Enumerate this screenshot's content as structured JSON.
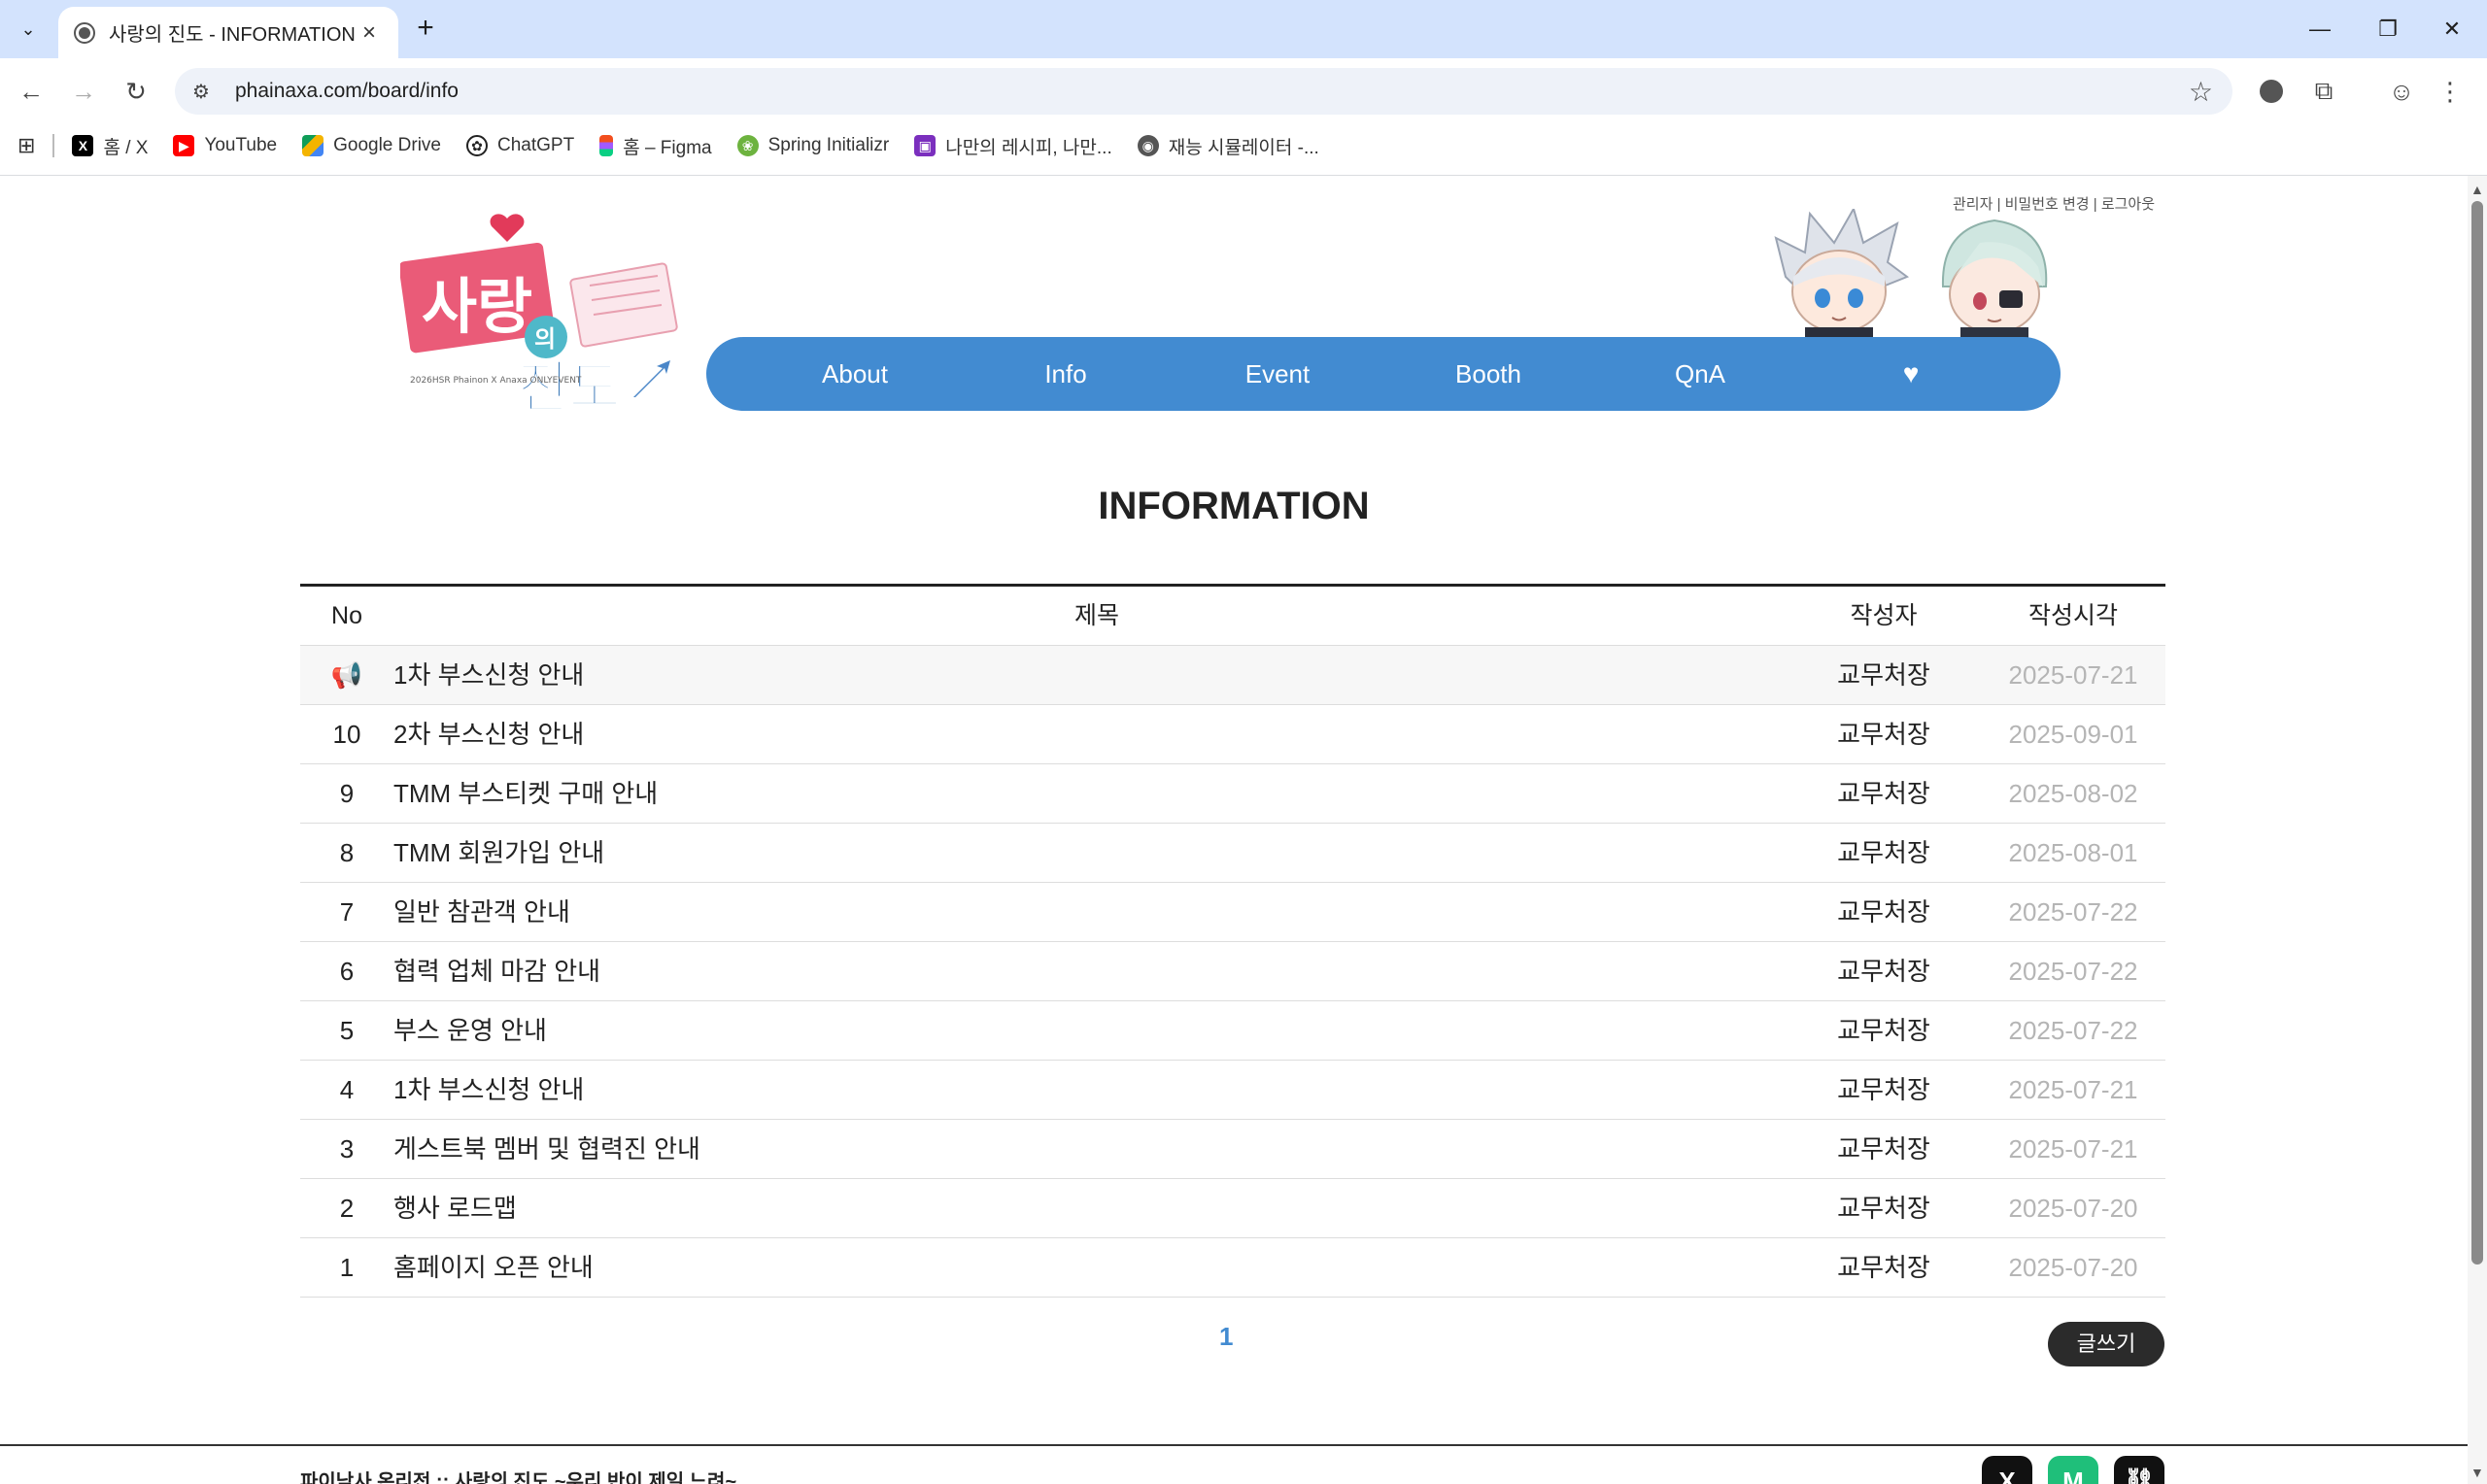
{
  "browser": {
    "tab_title": "사랑의 진도 - INFORMATION",
    "url": "phainaxa.com/board/info",
    "bookmarks": [
      {
        "label": "홈 / X",
        "icon": "x-logo-icon"
      },
      {
        "label": "YouTube",
        "icon": "youtube-icon"
      },
      {
        "label": "Google Drive",
        "icon": "google-drive-icon"
      },
      {
        "label": "ChatGPT",
        "icon": "chatgpt-icon"
      },
      {
        "label": "홈 – Figma",
        "icon": "figma-icon"
      },
      {
        "label": "Spring Initializr",
        "icon": "spring-icon"
      },
      {
        "label": "나만의 레시피, 나만...",
        "icon": "recipe-icon"
      },
      {
        "label": "재능 시뮬레이터 -...",
        "icon": "globe-icon"
      }
    ]
  },
  "site": {
    "top_links": "관리자 | 비밀번호 변경 | 로그아웃",
    "logo_lines": {
      "main1": "사랑",
      "small": "의",
      "main2": "진도",
      "sub": "2026HSR Phainon X Anaxa ONLYEVENT"
    },
    "nav": [
      {
        "label": "About"
      },
      {
        "label": "Info"
      },
      {
        "label": "Event"
      },
      {
        "label": "Booth"
      },
      {
        "label": "QnA"
      }
    ],
    "accent_color": "#428bd1"
  },
  "board": {
    "title": "INFORMATION",
    "columns": {
      "no": "No",
      "title": "제목",
      "author": "작성자",
      "date": "작성시각"
    },
    "notice_icon": "📢",
    "rows": [
      {
        "no": "",
        "title": "1차 부스신청 안내",
        "author": "교무처장",
        "date": "2025-07-21",
        "notice": true
      },
      {
        "no": "10",
        "title": "2차 부스신청 안내",
        "author": "교무처장",
        "date": "2025-09-01"
      },
      {
        "no": "9",
        "title": "TMM 부스티켓 구매 안내",
        "author": "교무처장",
        "date": "2025-08-02"
      },
      {
        "no": "8",
        "title": "TMM 회원가입 안내",
        "author": "교무처장",
        "date": "2025-08-01"
      },
      {
        "no": "7",
        "title": "일반 참관객 안내",
        "author": "교무처장",
        "date": "2025-07-22"
      },
      {
        "no": "6",
        "title": "협력 업체 마감 안내",
        "author": "교무처장",
        "date": "2025-07-22"
      },
      {
        "no": "5",
        "title": "부스 운영 안내",
        "author": "교무처장",
        "date": "2025-07-22"
      },
      {
        "no": "4",
        "title": "1차 부스신청 안내",
        "author": "교무처장",
        "date": "2025-07-21"
      },
      {
        "no": "3",
        "title": "게스트북 멤버 및 협력진 안내",
        "author": "교무처장",
        "date": "2025-07-21"
      },
      {
        "no": "2",
        "title": "행사 로드맵",
        "author": "교무처장",
        "date": "2025-07-20"
      },
      {
        "no": "1",
        "title": "홈페이지 오픈 안내",
        "author": "교무처장",
        "date": "2025-07-20"
      }
    ],
    "page": "1",
    "write_label": "글쓰기"
  },
  "footer": {
    "text": "파이낙사 온리전 :: 사랑의 진도 ~우리 반이 제일 느려~"
  }
}
